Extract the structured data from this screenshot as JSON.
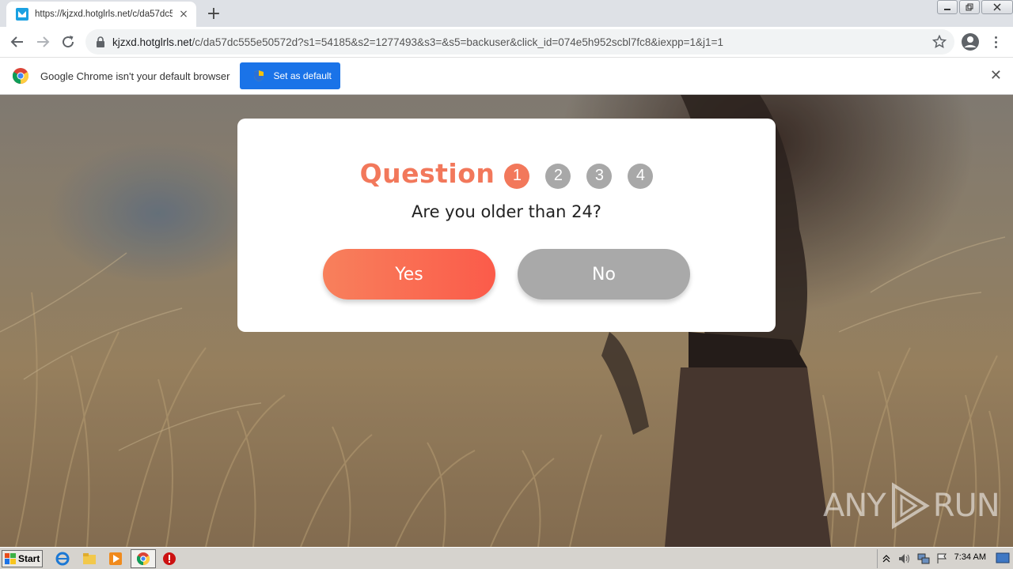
{
  "browser": {
    "tab": {
      "title": "https://kjzxd.hotglrls.net/c/da57dc5",
      "close_icon": "×"
    },
    "new_tab_icon": "+",
    "address": {
      "host": "kjzxd.hotglrls.net",
      "path": "/c/da57dc555e50572d?s1=54185&s2=1277493&s3=&s5=backuser&click_id=074e5h952scbl7fc8&iexpp=1&j1=1"
    }
  },
  "infobar": {
    "message": "Google Chrome isn't your default browser",
    "button_label": "Set as default",
    "close_icon": "✕"
  },
  "modal": {
    "heading": "Question",
    "steps": [
      "1",
      "2",
      "3",
      "4"
    ],
    "active_step": 1,
    "question": "Are you older than 24?",
    "yes_label": "Yes",
    "no_label": "No",
    "accent_color": "#f2785b",
    "inactive_color": "#a9a9a9"
  },
  "watermark": {
    "left": "ANY",
    "right": "RUN"
  },
  "taskbar": {
    "start_label": "Start",
    "clock": "7:34 AM"
  }
}
